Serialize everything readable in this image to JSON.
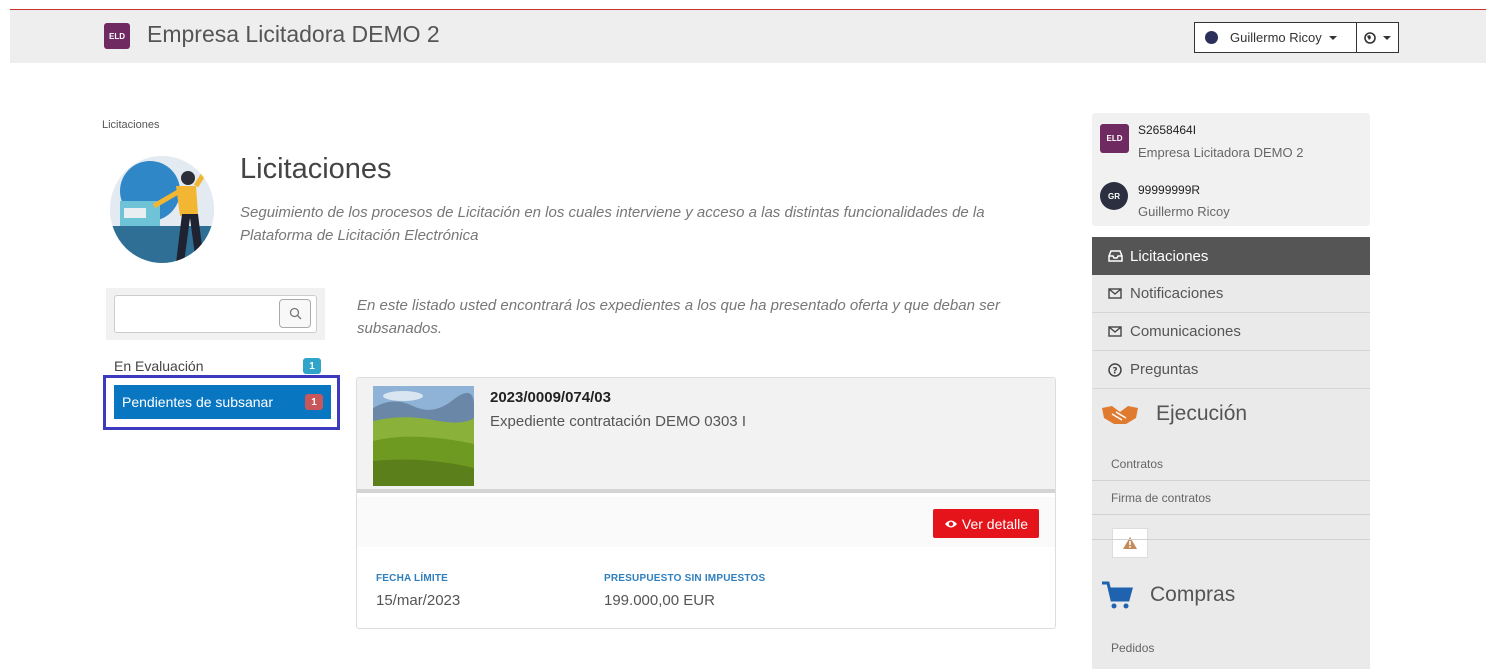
{
  "topbar": {
    "brand_badge": "ELD",
    "brand_name": "Empresa Licitadora DEMO 2",
    "user_name": "Guillermo Ricoy"
  },
  "breadcrumb": "Licitaciones",
  "header": {
    "title": "Licitaciones",
    "subtitle": "Seguimiento de los procesos de Licitación en los cuales interviene y acceso a las distintas funcionalidades de la Plataforma de Licitación Electrónica"
  },
  "search": {
    "placeholder": ""
  },
  "left_menu": {
    "items": [
      {
        "label": "En Evaluación",
        "count": "1"
      },
      {
        "label": "Pendientes de subsanar",
        "count": "1"
      }
    ]
  },
  "intro_text": "En este listado usted encontrará los expedientes a los que ha presentado oferta y que deban ser subsanados.",
  "expediente": {
    "code": "2023/0009/074/03",
    "description": "Expediente contratación DEMO 0303 I",
    "button_label": "Ver detalle",
    "fecha_label": "FECHA LÍMITE",
    "fecha_value": "15/mar/2023",
    "presupuesto_label": "PRESUPUESTO SIN IMPUESTOS",
    "presupuesto_value": "199.000,00 EUR"
  },
  "identity": {
    "company_badge": "ELD",
    "company_code": "S2658464I",
    "company_name": "Empresa Licitadora DEMO 2",
    "user_badge": "GR",
    "user_code": "99999999R",
    "user_name": "Guillermo Ricoy"
  },
  "side_nav": {
    "items": [
      {
        "label": "Licitaciones",
        "icon": "inbox-icon"
      },
      {
        "label": "Notificaciones",
        "icon": "envelope-icon"
      },
      {
        "label": "Comunicaciones",
        "icon": "envelope-icon"
      },
      {
        "label": "Preguntas",
        "icon": "question-icon"
      }
    ],
    "ejecucion": {
      "title": "Ejecución",
      "links": [
        "Contratos",
        "Firma de contratos"
      ]
    },
    "compras": {
      "title": "Compras",
      "links": [
        "Pedidos"
      ]
    }
  },
  "colors": {
    "active_menu": "#0876c0",
    "danger": "#e5141b",
    "brand": "#6f2a62",
    "highlight": "#3d3bbd"
  }
}
